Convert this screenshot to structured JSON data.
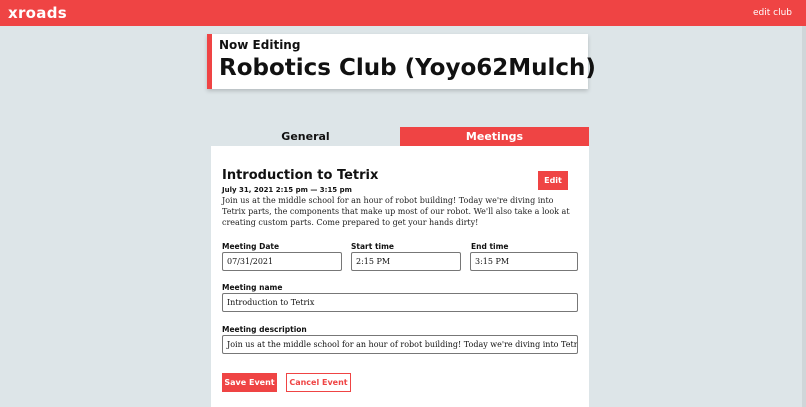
{
  "app": {
    "brand": "xroads",
    "nav_link": "edit club"
  },
  "header": {
    "eyebrow": "Now Editing",
    "club_name": "Robotics Club (Yoyo62Mulch)"
  },
  "tabs": [
    {
      "label": "General",
      "active": false
    },
    {
      "label": "Meetings",
      "active": true
    }
  ],
  "meeting": {
    "title": "Introduction to Tetrix",
    "datetime": "July 31, 2021 2:15 pm — 3:15 pm",
    "description": "Join us at the middle school for an hour of robot building! Today we're diving into Tetrix parts, the components that make up most of our robot. We'll also take a look at creating custom parts. Come prepared to get your hands dirty!",
    "edit_label": "Edit"
  },
  "form": {
    "date_label": "Meeting Date",
    "date_value": "07/31/2021",
    "start_label": "Start time",
    "start_value": "2:15 PM",
    "end_label": "End time",
    "end_value": "3:15 PM",
    "name_label": "Meeting name",
    "name_value": "Introduction to Tetrix",
    "desc_label": "Meeting description",
    "desc_value": "Join us at the middle school for an hour of robot building! Today we're diving into Tetrix parts, the components tha",
    "save_label": "Save Event",
    "cancel_label": "Cancel Event"
  },
  "colors": {
    "accent": "#ef4444",
    "background": "#dde5e8"
  }
}
